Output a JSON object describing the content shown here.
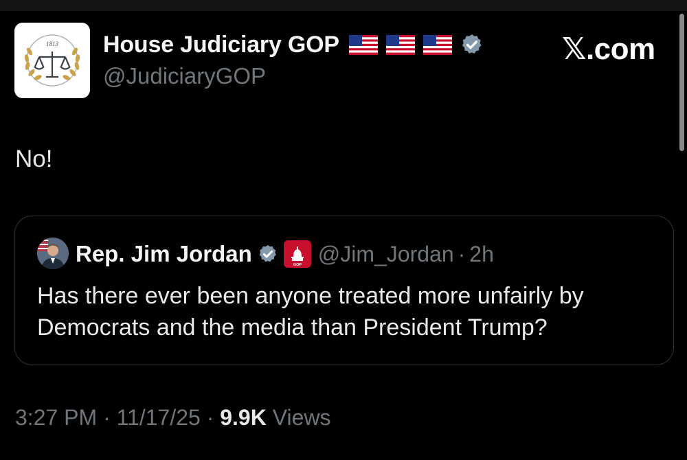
{
  "header": {
    "display_name": "House Judiciary GOP",
    "handle": "@JudiciaryGOP",
    "flag_icons": [
      "us-flag-icon",
      "us-flag-icon",
      "us-flag-icon"
    ],
    "verified_icon": "verified-badge-icon",
    "avatar_year": "1813",
    "brand": "𝕏.com"
  },
  "tweet": {
    "text": "No!"
  },
  "quote": {
    "display_name": "Rep. Jim Jordan",
    "handle": "@Jim_Jordan",
    "separator": "·",
    "time": "2h",
    "gop_badge_label": "GOP",
    "text": "Has there ever been anyone treated more unfairly by Democrats and the media than President Trump?"
  },
  "meta": {
    "time": "3:27 PM",
    "date": "11/17/25",
    "separator": "·",
    "views_count": "9.9K",
    "views_label": "Views"
  },
  "colors": {
    "background": "#000000",
    "text_primary": "#e7e9ea",
    "text_secondary": "#71767b",
    "verified_badge": "#829aab",
    "quote_border": "#2f3336",
    "gop_badge": "#c8102e"
  }
}
